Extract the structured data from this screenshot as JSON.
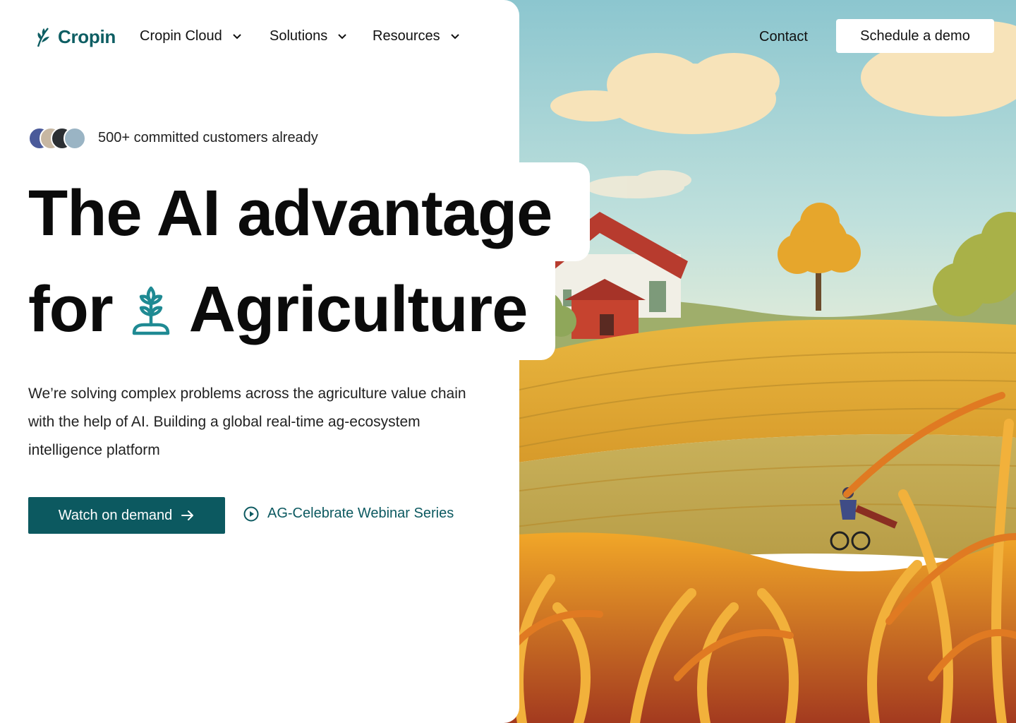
{
  "brand": {
    "name": "Cropin",
    "color": "#0e5e63"
  },
  "nav": {
    "items": [
      {
        "label": "Cropin Cloud"
      },
      {
        "label": "Solutions"
      },
      {
        "label": "Resources"
      }
    ],
    "contact": "Contact",
    "cta": "Schedule a demo"
  },
  "hero": {
    "customers_text": "500+ committed customers already",
    "headline_line1": "The AI advantage",
    "headline_line2_pre": "for",
    "headline_line2_post": "Agriculture",
    "description": "We’re solving complex problems across the agriculture value chain with the help of AI. Building a global real-time ag-ecosystem intelligence platform",
    "primary_cta": "Watch on demand",
    "secondary_cta": "AG-Celebrate Webinar Series"
  },
  "colors": {
    "primary": "#0c5960",
    "icon_teal": "#1f8a93"
  },
  "icons": [
    "cropin-logo-icon",
    "chevron-down-icon",
    "wheat-icon",
    "arrow-right-icon",
    "play-circle-icon"
  ]
}
